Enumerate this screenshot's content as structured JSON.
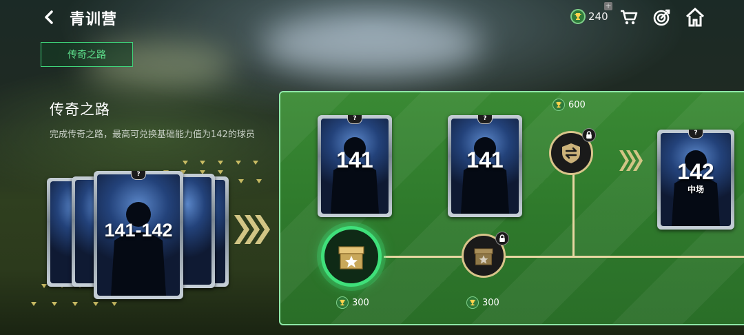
{
  "header": {
    "title": "青训营",
    "currency_value": "240",
    "plus": "+"
  },
  "tab": {
    "label": "传奇之路"
  },
  "info": {
    "title": "传奇之路",
    "description": "完成传奇之路，最高可兑换基础能力值为142的球员"
  },
  "pack": {
    "rating": "141-142",
    "badge": "?"
  },
  "path": {
    "card1": {
      "rating": "141",
      "badge": "?"
    },
    "card2": {
      "rating": "141",
      "badge": "?"
    },
    "final_card": {
      "rating": "142",
      "position": "中场",
      "badge": "?"
    },
    "exchange_cost": "600",
    "reward1_cost": "300",
    "reward2_cost": "300"
  },
  "colors": {
    "accent": "#3fe07a",
    "line": "#e8d7a2",
    "panel": "#2f7a2c"
  },
  "icons": [
    "back-icon",
    "trophy-icon",
    "cart-icon",
    "target-icon",
    "home-icon",
    "chest-icon",
    "swap-icon",
    "lock-icon",
    "chevron-right-icon"
  ]
}
